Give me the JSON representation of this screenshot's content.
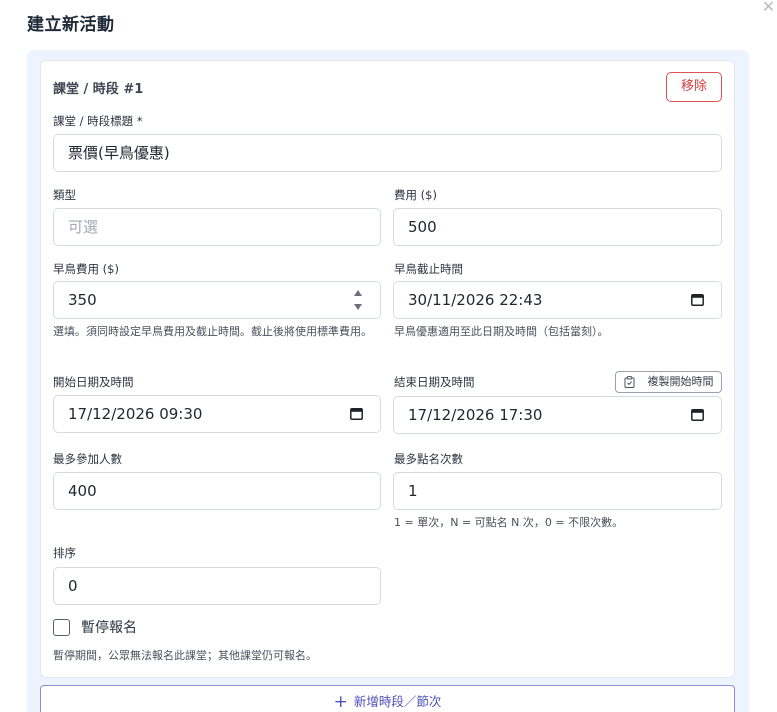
{
  "modal": {
    "title": "建立新活動",
    "close_symbol": "✕"
  },
  "session": {
    "heading": "課堂 / 時段 #1",
    "remove_label": "移除",
    "title_field": {
      "label": "課堂 / 時段標題 *",
      "value": "票價(早鳥優惠)"
    },
    "type_field": {
      "label": "類型",
      "placeholder": "可選",
      "value": ""
    },
    "fee_field": {
      "label": "費用 ($)",
      "value": "500"
    },
    "early_fee_field": {
      "label": "早鳥費用 ($)",
      "value": "350",
      "hint": "選填。須同時設定早鳥費用及截止時間。截止後將使用標準費用。"
    },
    "early_deadline_field": {
      "label": "早鳥截止時間",
      "value": "30/11/2026 22:43",
      "hint": "早鳥優惠適用至此日期及時間（包括當刻）。"
    },
    "start_field": {
      "label": "開始日期及時間",
      "value": "17/12/2026 09:30"
    },
    "end_field": {
      "label": "結束日期及時間",
      "value": "17/12/2026 17:30",
      "copy_label": "複製開始時間"
    },
    "max_participants_field": {
      "label": "最多參加人數",
      "value": "400"
    },
    "max_checkins_field": {
      "label": "最多點名次數",
      "value": "1",
      "hint": "1 = 單次，N = 可點名 N 次，0 = 不限次數。"
    },
    "order_field": {
      "label": "排序",
      "value": "0"
    },
    "pause_checkbox": {
      "label": "暫停報名",
      "checked": false,
      "hint": "暫停期間，公眾無法報名此課堂；其他課堂仍可報名。"
    }
  },
  "add_session": {
    "plus_symbol": "+",
    "label": "新增時段／節次"
  },
  "icons": {
    "calendar": "calendar-icon",
    "clipboard": "clipboard-icon",
    "spinner": "spinner-arrows-icon",
    "close": "close-icon"
  },
  "colors": {
    "danger": "#d63c3c",
    "accent": "#4f4fb8",
    "panel_bg": "#eef4ff"
  }
}
